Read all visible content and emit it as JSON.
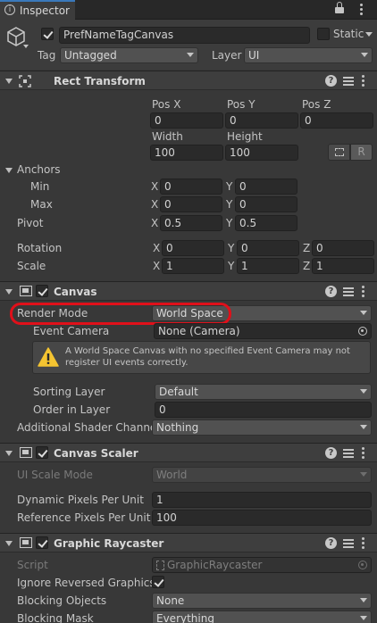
{
  "tab": {
    "title": "Inspector"
  },
  "object": {
    "name": "PrefNameTagCanvas",
    "static_label": "Static",
    "tag_label": "Tag",
    "tag_value": "Untagged",
    "layer_label": "Layer",
    "layer_value": "UI"
  },
  "rect_transform": {
    "title": "Rect Transform",
    "pos_x_label": "Pos X",
    "pos_y_label": "Pos Y",
    "pos_z_label": "Pos Z",
    "pos_x": "0",
    "pos_y": "0",
    "pos_z": "0",
    "width_label": "Width",
    "height_label": "Height",
    "width": "100",
    "height": "100",
    "raw_button": "R",
    "anchors_label": "Anchors",
    "min_label": "Min",
    "max_label": "Max",
    "min_x": "0",
    "min_y": "0",
    "max_x": "0",
    "max_y": "0",
    "pivot_label": "Pivot",
    "pivot_x": "0.5",
    "pivot_y": "0.5",
    "rotation_label": "Rotation",
    "rot_x": "0",
    "rot_y": "0",
    "rot_z": "0",
    "scale_label": "Scale",
    "scale_x": "1",
    "scale_y": "1",
    "scale_z": "1",
    "axis_x": "X",
    "axis_y": "Y",
    "axis_z": "Z"
  },
  "canvas": {
    "title": "Canvas",
    "render_mode_label": "Render Mode",
    "render_mode_value": "World Space",
    "event_camera_label": "Event Camera",
    "event_camera_value": "None (Camera)",
    "warning": "A World Space Canvas with no specified Event Camera may not register UI events correctly.",
    "sorting_layer_label": "Sorting Layer",
    "sorting_layer_value": "Default",
    "order_label": "Order in Layer",
    "order_value": "0",
    "shader_label": "Additional Shader Channel",
    "shader_value": "Nothing"
  },
  "canvas_scaler": {
    "title": "Canvas Scaler",
    "ui_scale_label": "UI Scale Mode",
    "ui_scale_value": "World",
    "dynamic_label": "Dynamic Pixels Per Unit",
    "dynamic_value": "1",
    "reference_label": "Reference Pixels Per Unit",
    "reference_value": "100"
  },
  "raycaster": {
    "title": "Graphic Raycaster",
    "script_label": "Script",
    "script_value": "GraphicRaycaster",
    "ignore_label": "Ignore Reversed Graphics",
    "blocking_objects_label": "Blocking Objects",
    "blocking_objects_value": "None",
    "blocking_mask_label": "Blocking Mask",
    "blocking_mask_value": "Everything"
  },
  "help_glyph": "?",
  "colors": {
    "highlight": "#e0101a",
    "warning": "#f4c431"
  }
}
